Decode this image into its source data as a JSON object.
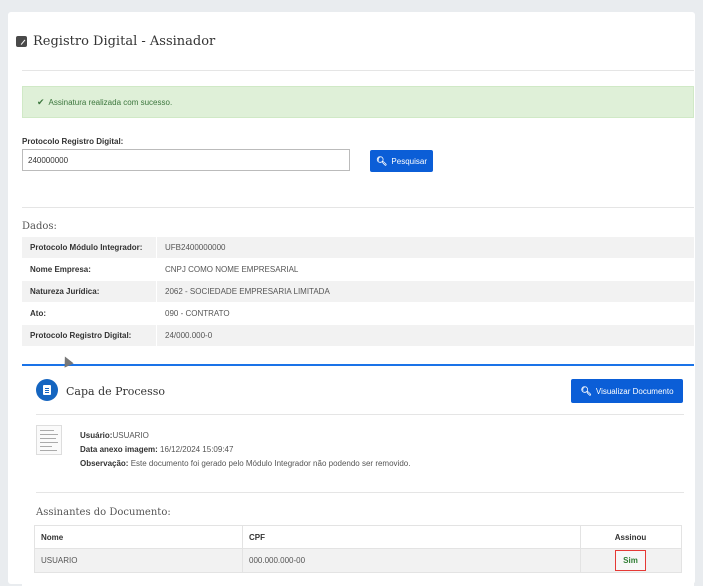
{
  "page": {
    "title": "Registro Digital - Assinador"
  },
  "alert": {
    "text": "Assinatura realizada com sucesso."
  },
  "search": {
    "label": "Protocolo Registro Digital:",
    "value": "240000000",
    "button_label": "Pesquisar"
  },
  "dados": {
    "heading": "Dados:",
    "rows": [
      {
        "key": "Protocolo Módulo Integrador:",
        "value": "UFB2400000000"
      },
      {
        "key": "Nome Empresa:",
        "value": "CNPJ COMO NOME EMPRESARIAL"
      },
      {
        "key": "Natureza Jurídica:",
        "value": "2062 - SOCIEDADE EMPRESARIA LIMITADA"
      },
      {
        "key": "Ato:",
        "value": "090 - CONTRATO"
      },
      {
        "key": "Protocolo Registro Digital:",
        "value": "24/000.000-0"
      }
    ]
  },
  "capa": {
    "title": "Capa de Processo",
    "button_label": "Visualizar Documento",
    "usuario_label": "Usuário:",
    "usuario_value": "USUARIO",
    "data_label": "Data anexo imagem:",
    "data_value": "16/12/2024 15:09:47",
    "obs_label": "Observação:",
    "obs_value": "Este documento foi gerado pelo Módulo Integrador não podendo ser removido."
  },
  "signers": {
    "heading": "Assinantes do Documento:",
    "columns": [
      "Nome",
      "CPF",
      "Assinou"
    ],
    "rows": [
      {
        "nome": "USUARIO",
        "cpf": "000.000.000-00",
        "assinou": "Sim"
      }
    ]
  },
  "colors": {
    "primary": "#0b5ed7",
    "success_bg": "#dff0d8",
    "success_text": "#3c763d",
    "highlight": "#e53935"
  },
  "icons": {
    "title": "edit-square-icon",
    "alert": "check-icon",
    "search": "search-icon",
    "capa": "document-icon"
  }
}
